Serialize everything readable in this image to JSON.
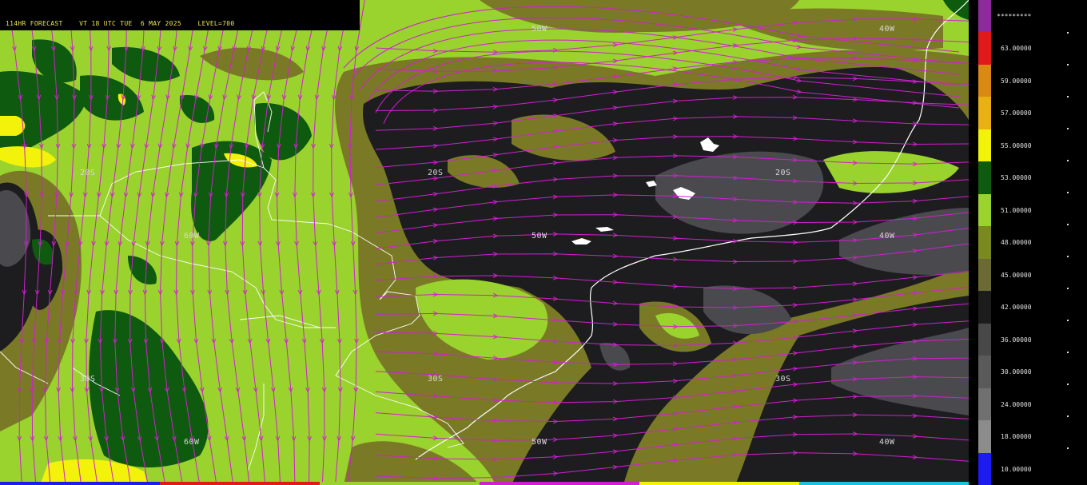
{
  "header": {
    "text": "114HR FORECAST    VT 18 UTC TUE  6 MAY 2025    LEVEL=700"
  },
  "grid_labels": [
    "50W",
    "40W",
    "20S",
    "20S",
    "20S",
    "60W",
    "50W",
    "40W",
    "30S",
    "30S",
    "30S",
    "60W",
    "50W",
    "40W"
  ],
  "legend": {
    "overflow_label": "*********",
    "levels": [
      "63.00000",
      "59.00000",
      "57.00000",
      "55.00000",
      "53.00000",
      "51.00000",
      "48.00000",
      "45.00000",
      "42.00000",
      "36.00000",
      "30.00000",
      "24.00000",
      "18.00000",
      "10.00000"
    ],
    "colors": [
      "#8d2a9c",
      "#e01a1a",
      "#d98a12",
      "#e8b012",
      "#f2f20a",
      "#0e5a0e",
      "#9ad22e",
      "#7a8a1e",
      "#6b6a34",
      "#1c1c1c",
      "#484848",
      "#5a5a5a",
      "#707070",
      "#8c8c8c",
      "#1c1cf0"
    ]
  },
  "colors": {
    "streamline": "#d020d0",
    "coast": "#ffffff",
    "dark_green": "#0e5a0e",
    "light_green": "#9ad22e",
    "olive": "#7a7a26",
    "charcoal": "#1d1d1f",
    "gray": "#4a4a4e"
  }
}
